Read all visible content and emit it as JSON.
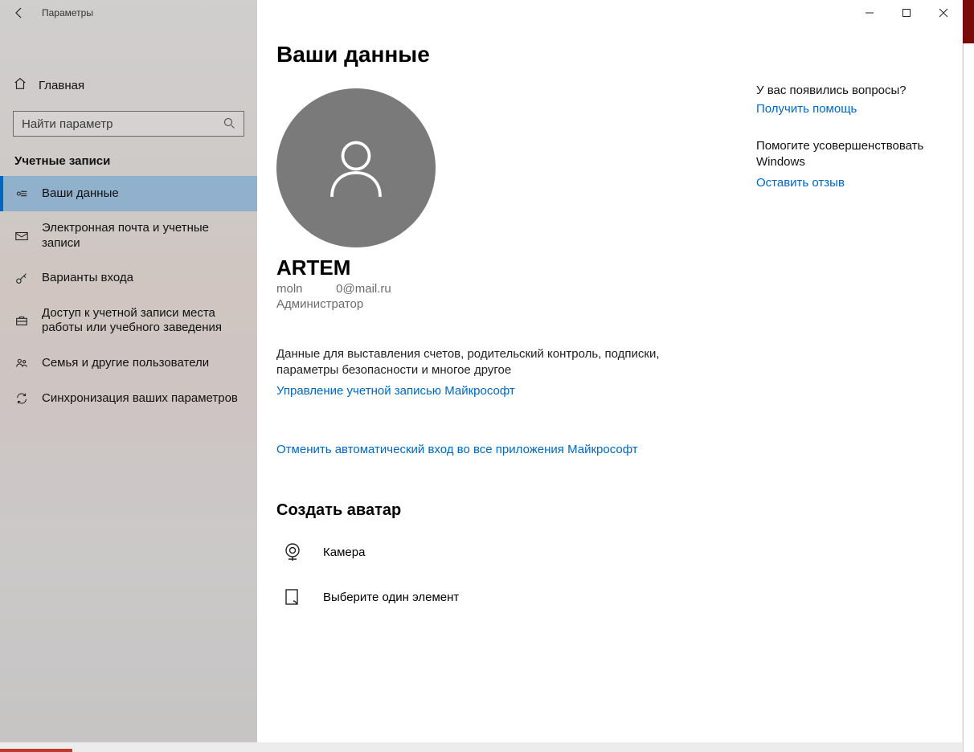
{
  "titlebar": {
    "title": "Параметры"
  },
  "sidebar": {
    "home": "Главная",
    "search_placeholder": "Найти параметр",
    "section": "Учетные записи",
    "items": [
      {
        "label": "Ваши данные"
      },
      {
        "label": "Электронная почта и учетные записи"
      },
      {
        "label": "Варианты входа"
      },
      {
        "label": "Доступ к учетной записи места работы или учебного заведения"
      },
      {
        "label": "Семья и другие пользователи"
      },
      {
        "label": "Синхронизация ваших параметров"
      }
    ]
  },
  "main": {
    "page_title": "Ваши данные",
    "username": "ARTEM",
    "email": "moln          0@mail.ru",
    "role": "Администратор",
    "blurb": "Данные для выставления счетов, родительский контроль, подписки, параметры безопасности и многое другое",
    "manage_link": "Управление учетной записью Майкрософт",
    "cancel_link": "Отменить автоматический вход во все приложения Майкрософт",
    "create_avatar": "Создать аватар",
    "camera": "Камера",
    "pick_one": "Выберите один элемент"
  },
  "help": {
    "questions": "У вас появились вопросы?",
    "get_help": "Получить помощь",
    "improve": "Помогите усовершенствовать Windows",
    "feedback": "Оставить отзыв"
  }
}
